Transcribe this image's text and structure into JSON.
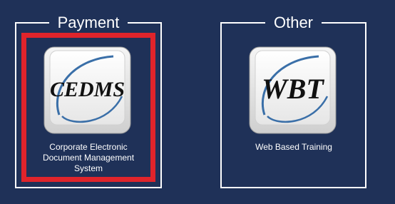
{
  "groups": {
    "payment": {
      "title": "Payment",
      "tiles": [
        {
          "logo_text": "CEDMS",
          "caption": "Corporate Electronic Document Management System",
          "icon": "cedms-logo-icon",
          "selected": true
        }
      ]
    },
    "other": {
      "title": "Other",
      "tiles": [
        {
          "logo_text": "WBT",
          "caption": "Web Based Training",
          "icon": "wbt-logo-icon",
          "selected": false
        }
      ]
    }
  },
  "colors": {
    "background": "#1f3158",
    "border": "#ffffff",
    "highlight": "#e0242b",
    "swoosh": "#3a6fa8"
  }
}
